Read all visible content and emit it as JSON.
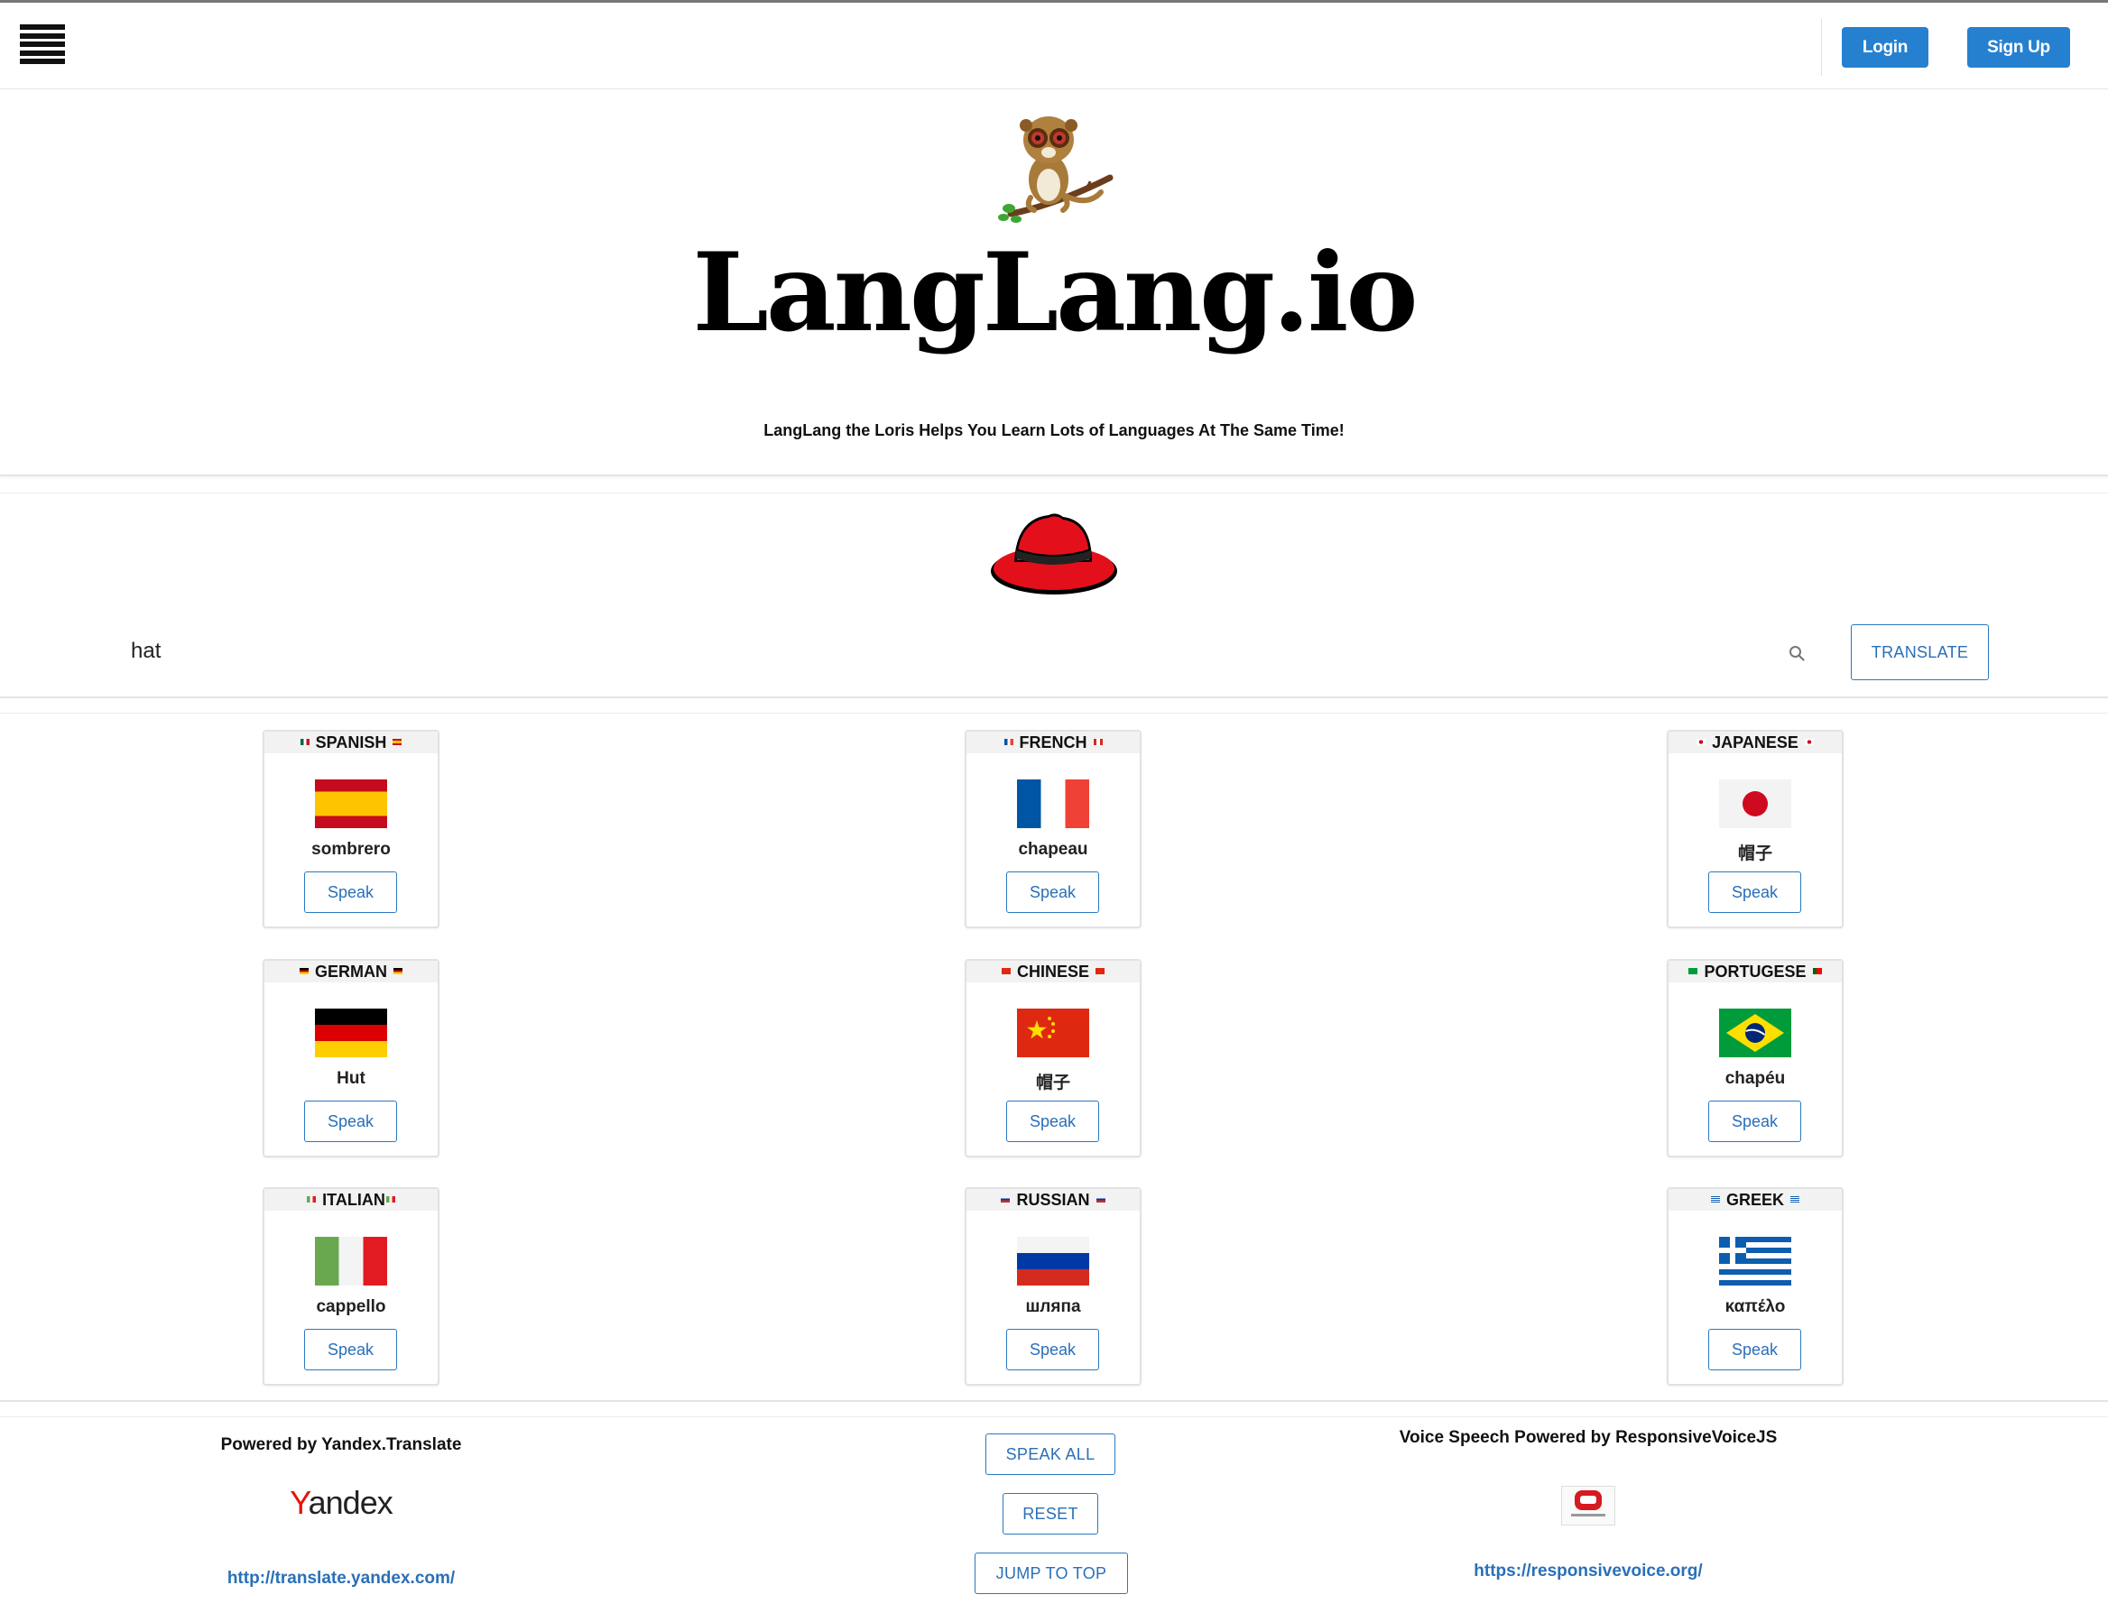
{
  "nav": {
    "login_label": "Login",
    "signup_label": "Sign Up"
  },
  "hero": {
    "brand": "LangLang.io",
    "tagline": "LangLang the Loris Helps You Learn Lots of Languages At The Same Time!"
  },
  "search": {
    "value": "hat",
    "translate_label": "TRANSLATE"
  },
  "results": [
    {
      "language": "SPANISH",
      "word": "sombrero",
      "speak_label": "Speak",
      "flag": "spain-flag"
    },
    {
      "language": "FRENCH",
      "word": "chapeau",
      "speak_label": "Speak",
      "flag": "france-flag"
    },
    {
      "language": "JAPANESE",
      "word": "帽子",
      "speak_label": "Speak",
      "flag": "japan-flag"
    },
    {
      "language": "GERMAN",
      "word": "Hut",
      "speak_label": "Speak",
      "flag": "germany-flag"
    },
    {
      "language": "CHINESE",
      "word": "帽子",
      "speak_label": "Speak",
      "flag": "china-flag"
    },
    {
      "language": "PORTUGESE",
      "word": "chapéu",
      "speak_label": "Speak",
      "flag": "brazil-flag"
    },
    {
      "language": "ITALIAN",
      "word": "cappello",
      "speak_label": "Speak",
      "flag": "italy-flag"
    },
    {
      "language": "RUSSIAN",
      "word": "шляпа",
      "speak_label": "Speak",
      "flag": "russia-flag"
    },
    {
      "language": "GREEK",
      "word": "καπέλο",
      "speak_label": "Speak",
      "flag": "greece-flag"
    }
  ],
  "footer": {
    "yandex_credit": "Powered by Yandex.Translate",
    "yandex_logo": "Yandex",
    "yandex_link": "http://translate.yandex.com/",
    "speak_all_label": "SPEAK ALL",
    "reset_label": "RESET",
    "jump_label": "JUMP TO TOP",
    "voice_credit": "Voice Speech Powered by ResponsiveVoiceJS",
    "voice_link": "https://responsivevoice.org/"
  },
  "colors": {
    "accent": "#2680d0",
    "link": "#2a6fb8",
    "hat_red": "#e3101c"
  }
}
